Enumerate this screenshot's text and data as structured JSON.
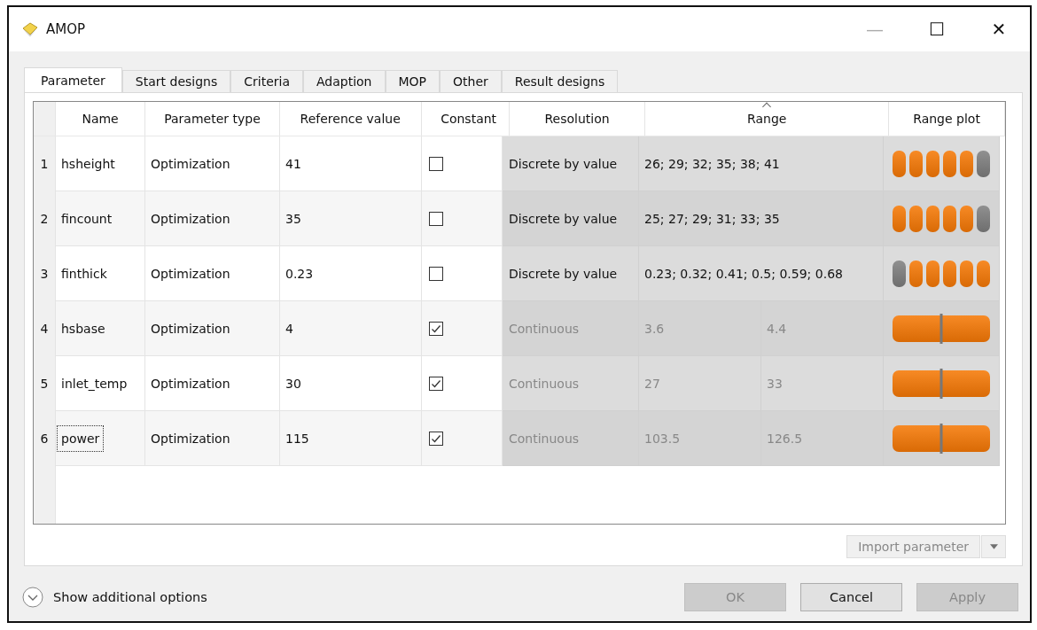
{
  "window": {
    "title": "AMOP",
    "controls": [
      "—",
      "☐",
      "✕"
    ]
  },
  "tabs": [
    {
      "label": "Parameter",
      "selected": true
    },
    {
      "label": "Start designs",
      "selected": false
    },
    {
      "label": "Criteria",
      "selected": false
    },
    {
      "label": "Adaption",
      "selected": false
    },
    {
      "label": "MOP",
      "selected": false
    },
    {
      "label": "Other",
      "selected": false
    },
    {
      "label": "Result designs",
      "selected": false
    }
  ],
  "table": {
    "columns": [
      {
        "label": "Name",
        "sorted": false
      },
      {
        "label": "Parameter type",
        "sorted": false
      },
      {
        "label": "Reference value",
        "sorted": false
      },
      {
        "label": "Constant",
        "sorted": false
      },
      {
        "label": "Resolution",
        "sorted": false
      },
      {
        "label": "Range",
        "sorted": true
      },
      {
        "label": "Range plot",
        "sorted": false
      }
    ],
    "rows": [
      {
        "index": "1",
        "name": "hsheight",
        "type": "Optimization",
        "reference": "41",
        "constant": false,
        "focused": false,
        "kind": "discrete",
        "disabled": false,
        "resolution": "Discrete by value",
        "range": "26; 29; 32; 35; 38; 41",
        "plot": [
          {
            "selected": false
          },
          {
            "selected": false
          },
          {
            "selected": false
          },
          {
            "selected": false
          },
          {
            "selected": false
          },
          {
            "selected": true
          }
        ]
      },
      {
        "index": "2",
        "name": "fincount",
        "type": "Optimization",
        "reference": "35",
        "constant": false,
        "focused": false,
        "kind": "discrete",
        "disabled": false,
        "resolution": "Discrete by value",
        "range": "25; 27; 29; 31; 33; 35",
        "plot": [
          {
            "selected": false
          },
          {
            "selected": false
          },
          {
            "selected": false
          },
          {
            "selected": false
          },
          {
            "selected": false
          },
          {
            "selected": true
          }
        ]
      },
      {
        "index": "3",
        "name": "finthick",
        "type": "Optimization",
        "reference": "0.23",
        "constant": false,
        "focused": false,
        "kind": "discrete",
        "disabled": false,
        "resolution": "Discrete by value",
        "range": "0.23; 0.32; 0.41; 0.5; 0.59; 0.68",
        "plot": [
          {
            "selected": true
          },
          {
            "selected": false
          },
          {
            "selected": false
          },
          {
            "selected": false
          },
          {
            "selected": false
          },
          {
            "selected": false
          }
        ]
      },
      {
        "index": "4",
        "name": "hsbase",
        "type": "Optimization",
        "reference": "4",
        "constant": true,
        "focused": false,
        "kind": "continuous",
        "disabled": true,
        "resolution": "Continuous",
        "min": "3.6",
        "max": "4.4",
        "level": 0.5
      },
      {
        "index": "5",
        "name": "inlet_temp",
        "type": "Optimization",
        "reference": "30",
        "constant": true,
        "focused": false,
        "kind": "continuous",
        "disabled": true,
        "resolution": "Continuous",
        "min": "27",
        "max": "33",
        "level": 0.5
      },
      {
        "index": "6",
        "name": "power",
        "type": "Optimization",
        "reference": "115",
        "constant": true,
        "focused": true,
        "kind": "continuous",
        "disabled": true,
        "resolution": "Continuous",
        "min": "103.5",
        "max": "126.5",
        "level": 0.5
      }
    ]
  },
  "import_button": {
    "label": "Import parameter",
    "disabled": true
  },
  "additional_options": {
    "label": "Show additional options"
  },
  "buttons": [
    {
      "label": "OK",
      "disabled": true
    },
    {
      "label": "Cancel",
      "disabled": false
    },
    {
      "label": "Apply",
      "disabled": true
    }
  ]
}
